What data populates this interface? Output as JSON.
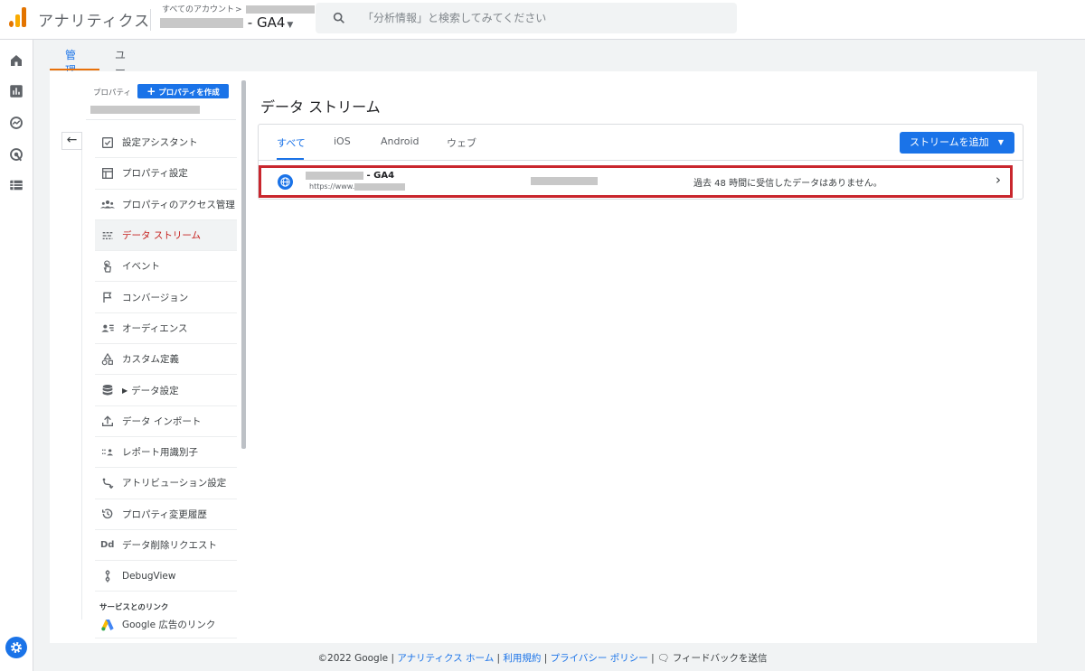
{
  "header": {
    "app_title": "アナリティクス",
    "account_crumb": "すべてのアカウント",
    "property_suffix": "- GA4",
    "search_placeholder": "「分析情報」と検索してみてください"
  },
  "tabs": [
    {
      "label": "管理"
    },
    {
      "label": "ユーザー"
    }
  ],
  "nav": {
    "property_label": "プロパティ",
    "create_property": "プロパティを作成",
    "items": [
      {
        "label": "設定アシスタント",
        "icon": "checklist-icon"
      },
      {
        "label": "プロパティ設定",
        "icon": "property-icon"
      },
      {
        "label": "プロパティのアクセス管理",
        "icon": "people-icon"
      },
      {
        "label": "データ ストリーム",
        "icon": "stream-icon"
      },
      {
        "label": "イベント",
        "icon": "touch-icon"
      },
      {
        "label": "コンバージョン",
        "icon": "flag-icon"
      },
      {
        "label": "オーディエンス",
        "icon": "audience-icon"
      },
      {
        "label": "カスタム定義",
        "icon": "shapes-icon"
      },
      {
        "label": "データ設定",
        "icon": "database-icon"
      },
      {
        "label": "データ インポート",
        "icon": "upload-icon"
      },
      {
        "label": "レポート用識別子",
        "icon": "identity-icon"
      },
      {
        "label": "アトリビューション設定",
        "icon": "attribution-icon"
      },
      {
        "label": "プロパティ変更履歴",
        "icon": "history-icon"
      },
      {
        "label": "データ削除リクエスト",
        "icon": "dd-icon"
      },
      {
        "label": "DebugView",
        "icon": "debug-icon"
      }
    ],
    "selected_index": 3,
    "section_header": "サービスとのリンク",
    "google_ads_link": "Google 広告のリンク"
  },
  "content": {
    "title": "データ ストリーム",
    "tabs": [
      {
        "label": "すべて"
      },
      {
        "label": "iOS"
      },
      {
        "label": "Android"
      },
      {
        "label": "ウェブ"
      }
    ],
    "add_stream": "ストリームを追加",
    "stream": {
      "name_suffix": "- GA4",
      "url_prefix": "https://www.",
      "status": "過去 48 時間に受信したデータはありません。"
    }
  },
  "footer": {
    "copyright": "©2022 Google",
    "home": "アナリティクス ホーム",
    "terms": "利用規約",
    "privacy": "プライバシー ポリシー",
    "feedback": "フィードバックを送信"
  },
  "colors": {
    "accent": "#1a73e8",
    "selected_text": "#c5221f",
    "highlight_border": "#c9262d",
    "tab_underline": "#e8710a"
  }
}
